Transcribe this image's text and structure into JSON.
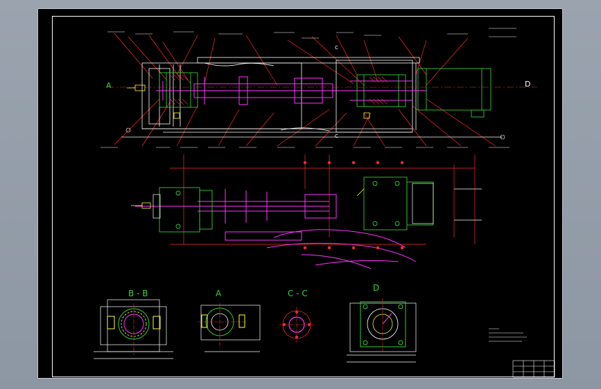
{
  "sections": {
    "bb": "B - B",
    "a": "A",
    "cc": "C - C",
    "d": "D"
  },
  "markers": {
    "a_left": "A",
    "d_right": "D",
    "c_top": "C",
    "c_bottom": "C"
  },
  "colors": {
    "background": "#000000",
    "outline": "#ffffff",
    "green": "#33cc33",
    "magenta": "#ff33ff",
    "red": "#ff2a2a",
    "yellow": "#ffff33",
    "cyan": "#33e0ff"
  }
}
